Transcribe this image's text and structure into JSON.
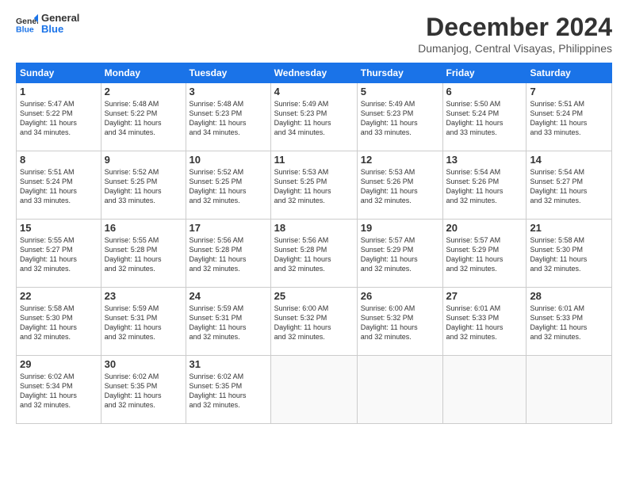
{
  "logo": {
    "line1": "General",
    "line2": "Blue"
  },
  "title": "December 2024",
  "subtitle": "Dumanjog, Central Visayas, Philippines",
  "weekdays": [
    "Sunday",
    "Monday",
    "Tuesday",
    "Wednesday",
    "Thursday",
    "Friday",
    "Saturday"
  ],
  "weeks": [
    [
      {
        "day": "1",
        "info": "Sunrise: 5:47 AM\nSunset: 5:22 PM\nDaylight: 11 hours\nand 34 minutes."
      },
      {
        "day": "2",
        "info": "Sunrise: 5:48 AM\nSunset: 5:22 PM\nDaylight: 11 hours\nand 34 minutes."
      },
      {
        "day": "3",
        "info": "Sunrise: 5:48 AM\nSunset: 5:23 PM\nDaylight: 11 hours\nand 34 minutes."
      },
      {
        "day": "4",
        "info": "Sunrise: 5:49 AM\nSunset: 5:23 PM\nDaylight: 11 hours\nand 34 minutes."
      },
      {
        "day": "5",
        "info": "Sunrise: 5:49 AM\nSunset: 5:23 PM\nDaylight: 11 hours\nand 33 minutes."
      },
      {
        "day": "6",
        "info": "Sunrise: 5:50 AM\nSunset: 5:24 PM\nDaylight: 11 hours\nand 33 minutes."
      },
      {
        "day": "7",
        "info": "Sunrise: 5:51 AM\nSunset: 5:24 PM\nDaylight: 11 hours\nand 33 minutes."
      }
    ],
    [
      {
        "day": "8",
        "info": "Sunrise: 5:51 AM\nSunset: 5:24 PM\nDaylight: 11 hours\nand 33 minutes."
      },
      {
        "day": "9",
        "info": "Sunrise: 5:52 AM\nSunset: 5:25 PM\nDaylight: 11 hours\nand 33 minutes."
      },
      {
        "day": "10",
        "info": "Sunrise: 5:52 AM\nSunset: 5:25 PM\nDaylight: 11 hours\nand 32 minutes."
      },
      {
        "day": "11",
        "info": "Sunrise: 5:53 AM\nSunset: 5:25 PM\nDaylight: 11 hours\nand 32 minutes."
      },
      {
        "day": "12",
        "info": "Sunrise: 5:53 AM\nSunset: 5:26 PM\nDaylight: 11 hours\nand 32 minutes."
      },
      {
        "day": "13",
        "info": "Sunrise: 5:54 AM\nSunset: 5:26 PM\nDaylight: 11 hours\nand 32 minutes."
      },
      {
        "day": "14",
        "info": "Sunrise: 5:54 AM\nSunset: 5:27 PM\nDaylight: 11 hours\nand 32 minutes."
      }
    ],
    [
      {
        "day": "15",
        "info": "Sunrise: 5:55 AM\nSunset: 5:27 PM\nDaylight: 11 hours\nand 32 minutes."
      },
      {
        "day": "16",
        "info": "Sunrise: 5:55 AM\nSunset: 5:28 PM\nDaylight: 11 hours\nand 32 minutes."
      },
      {
        "day": "17",
        "info": "Sunrise: 5:56 AM\nSunset: 5:28 PM\nDaylight: 11 hours\nand 32 minutes."
      },
      {
        "day": "18",
        "info": "Sunrise: 5:56 AM\nSunset: 5:28 PM\nDaylight: 11 hours\nand 32 minutes."
      },
      {
        "day": "19",
        "info": "Sunrise: 5:57 AM\nSunset: 5:29 PM\nDaylight: 11 hours\nand 32 minutes."
      },
      {
        "day": "20",
        "info": "Sunrise: 5:57 AM\nSunset: 5:29 PM\nDaylight: 11 hours\nand 32 minutes."
      },
      {
        "day": "21",
        "info": "Sunrise: 5:58 AM\nSunset: 5:30 PM\nDaylight: 11 hours\nand 32 minutes."
      }
    ],
    [
      {
        "day": "22",
        "info": "Sunrise: 5:58 AM\nSunset: 5:30 PM\nDaylight: 11 hours\nand 32 minutes."
      },
      {
        "day": "23",
        "info": "Sunrise: 5:59 AM\nSunset: 5:31 PM\nDaylight: 11 hours\nand 32 minutes."
      },
      {
        "day": "24",
        "info": "Sunrise: 5:59 AM\nSunset: 5:31 PM\nDaylight: 11 hours\nand 32 minutes."
      },
      {
        "day": "25",
        "info": "Sunrise: 6:00 AM\nSunset: 5:32 PM\nDaylight: 11 hours\nand 32 minutes."
      },
      {
        "day": "26",
        "info": "Sunrise: 6:00 AM\nSunset: 5:32 PM\nDaylight: 11 hours\nand 32 minutes."
      },
      {
        "day": "27",
        "info": "Sunrise: 6:01 AM\nSunset: 5:33 PM\nDaylight: 11 hours\nand 32 minutes."
      },
      {
        "day": "28",
        "info": "Sunrise: 6:01 AM\nSunset: 5:33 PM\nDaylight: 11 hours\nand 32 minutes."
      }
    ],
    [
      {
        "day": "29",
        "info": "Sunrise: 6:02 AM\nSunset: 5:34 PM\nDaylight: 11 hours\nand 32 minutes."
      },
      {
        "day": "30",
        "info": "Sunrise: 6:02 AM\nSunset: 5:35 PM\nDaylight: 11 hours\nand 32 minutes."
      },
      {
        "day": "31",
        "info": "Sunrise: 6:02 AM\nSunset: 5:35 PM\nDaylight: 11 hours\nand 32 minutes."
      },
      null,
      null,
      null,
      null
    ]
  ]
}
